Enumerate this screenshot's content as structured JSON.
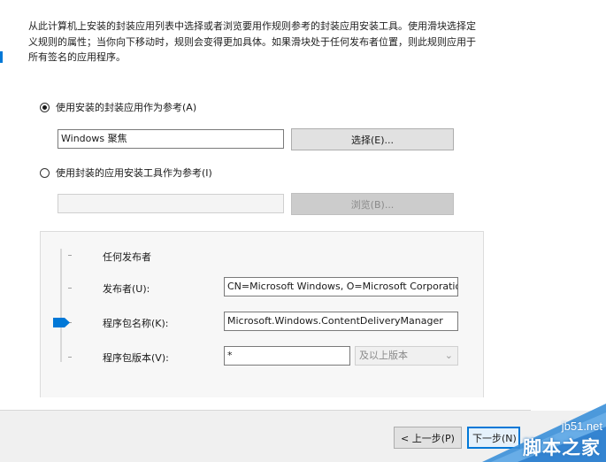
{
  "description": "从此计算机上安装的封装应用列表中选择或者浏览要用作规则参考的封装应用安装工具。使用滑块选择定义规则的属性；当你向下移动时，规则会变得更加具体。如果滑块处于任何发布者位置，则此规则应用于所有签名的应用程序。",
  "option_installed": {
    "label": "使用安装的封装应用作为参考(A)",
    "selected": true,
    "value": "Windows 聚焦",
    "select_label": "选择(E)..."
  },
  "option_installer": {
    "label": "使用封装的应用安装工具作为参考(I)",
    "selected": false,
    "value": "",
    "browse_label": "浏览(B)..."
  },
  "slider": {
    "position": "package-name",
    "any_publisher_label": "任何发布者",
    "publisher_label": "发布者(U):",
    "publisher_value": "CN=Microsoft Windows, O=Microsoft Corporation",
    "package_name_label": "程序包名称(K):",
    "package_name_value": "Microsoft.Windows.ContentDeliveryManager",
    "package_version_label": "程序包版本(V):",
    "package_version_value": "*",
    "version_option": "及以上版本"
  },
  "footer": {
    "prev_label": "< 上一步(P)",
    "next_label": "下一步(N) >"
  },
  "watermark": {
    "url": "jb51.net",
    "text": "脚本之家"
  },
  "colors": {
    "accent": "#0078d7",
    "watermark": "#3a8fd8"
  }
}
